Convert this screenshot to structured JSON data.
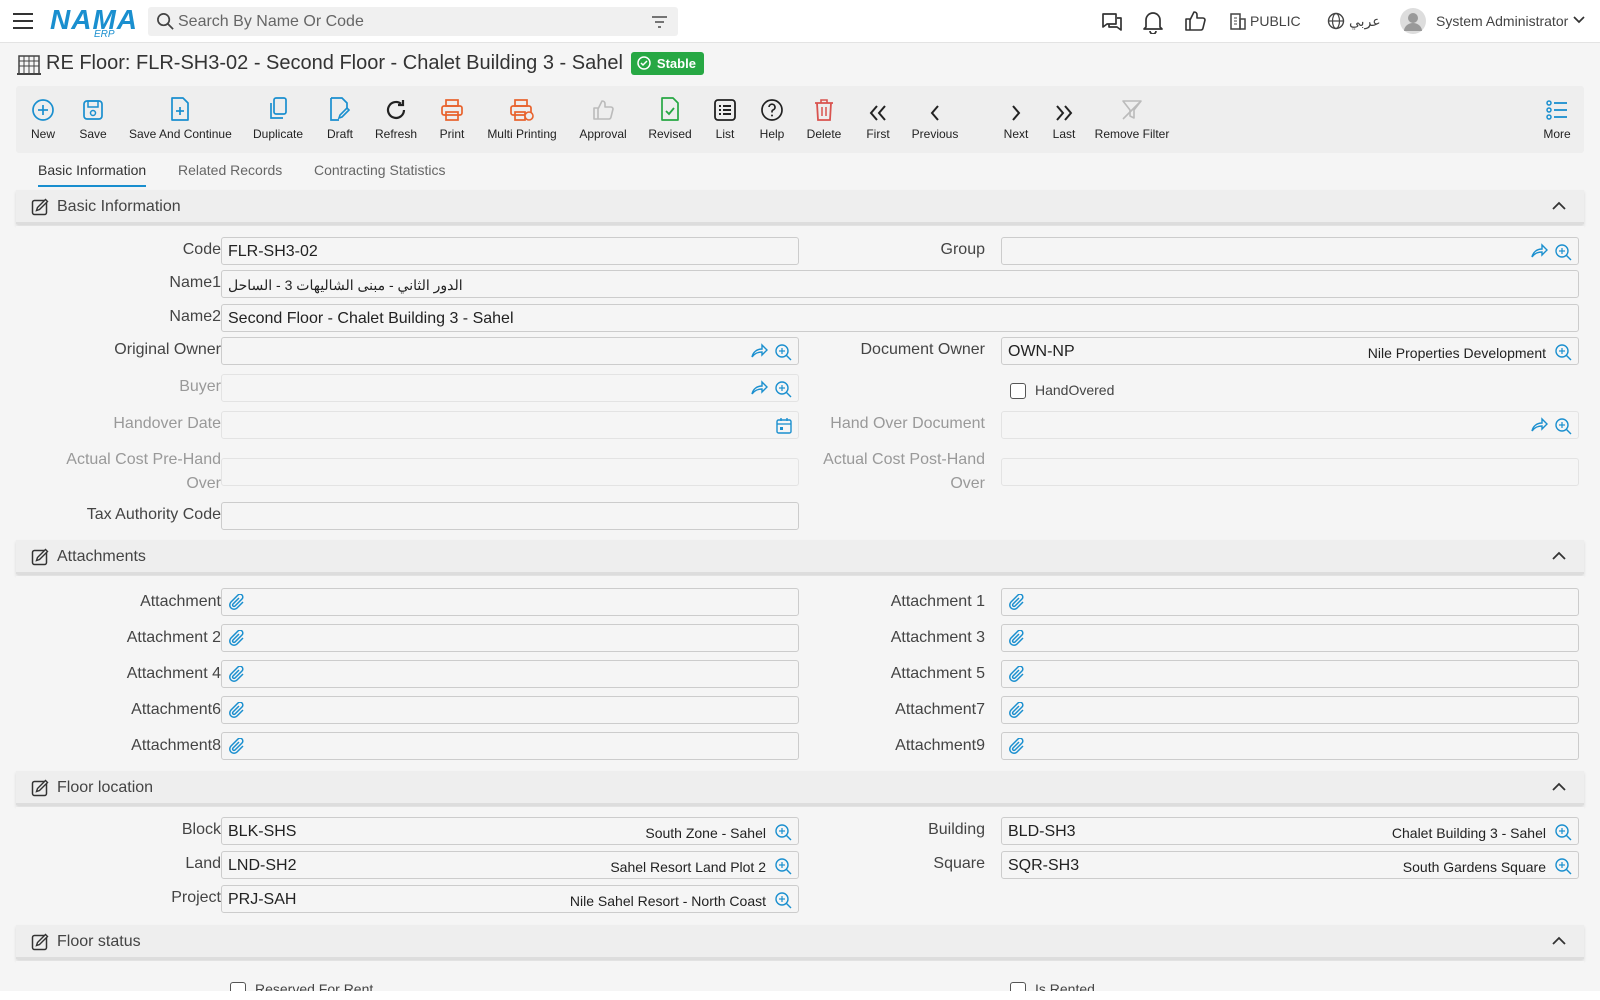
{
  "app": {
    "logo_text": "NAMA",
    "logo_sub": "ERP",
    "search_placeholder": "Search By Name Or Code",
    "branch": "PUBLIC",
    "language": "عربي",
    "user": "System Administrator"
  },
  "page": {
    "title": "RE Floor: FLR-SH3-02 - Second Floor - Chalet Building 3 - Sahel",
    "status": "Stable",
    "status_color": "#27a844"
  },
  "toolbar": {
    "new": "New",
    "save": "Save",
    "save_continue": "Save And Continue",
    "duplicate": "Duplicate",
    "draft": "Draft",
    "refresh": "Refresh",
    "print": "Print",
    "multi_printing": "Multi Printing",
    "approval": "Approval",
    "revised": "Revised",
    "list": "List",
    "help": "Help",
    "delete": "Delete",
    "first": "First",
    "previous": "Previous",
    "next": "Next",
    "last": "Last",
    "remove_filter": "Remove Filter",
    "more": "More"
  },
  "tabs": [
    "Basic Information",
    "Related Records",
    "Contracting Statistics"
  ],
  "basic": {
    "title": "Basic Information",
    "code_label": "Code",
    "code_value": "FLR-SH3-02",
    "group_label": "Group",
    "name1_label": "Name1",
    "name1_value": "الدور الثاني - مبنى الشاليهات 3 - الساحل",
    "name2_label": "Name2",
    "name2_value": "Second Floor - Chalet Building 3 - Sahel",
    "original_owner_label": "Original Owner",
    "document_owner_label": "Document Owner",
    "document_owner_code": "OWN-NP",
    "document_owner_name": "Nile Properties Development",
    "buyer_label": "Buyer",
    "handovered_label": "HandOvered",
    "handover_date_label": "Handover Date",
    "handover_document_label": "Hand Over Document",
    "cost_pre_label_1": "Actual Cost Pre-Hand",
    "cost_pre_label_2": "Over",
    "cost_post_label_1": "Actual Cost Post-Hand",
    "cost_post_label_2": "Over",
    "tax_label": "Tax Authority Code"
  },
  "attachments": {
    "title": "Attachments",
    "labels": [
      "Attachment",
      "Attachment 1",
      "Attachment 2",
      "Attachment 3",
      "Attachment 4",
      "Attachment 5",
      "Attachment6",
      "Attachment7",
      "Attachment8",
      "Attachment9"
    ]
  },
  "location": {
    "title": "Floor location",
    "block_label": "Block",
    "block_code": "BLK-SHS",
    "block_name": "South Zone - Sahel",
    "building_label": "Building",
    "building_code": "BLD-SH3",
    "building_name": "Chalet Building 3 - Sahel",
    "land_label": "Land",
    "land_code": "LND-SH2",
    "land_name": "Sahel Resort Land Plot 2",
    "square_label": "Square",
    "square_code": "SQR-SH3",
    "square_name": "South Gardens Square",
    "project_label": "Project",
    "project_code": "PRJ-SAH",
    "project_name": "Nile Sahel Resort - North Coast"
  },
  "status_section": {
    "title": "Floor status",
    "reserved_label": "Reserved For Rent",
    "rented_label": "Is Rented"
  },
  "colors": {
    "accent": "#1a8fcf",
    "print_orange": "#e8622c",
    "approval_green": "#27a844",
    "delete_red": "#d9534f"
  }
}
